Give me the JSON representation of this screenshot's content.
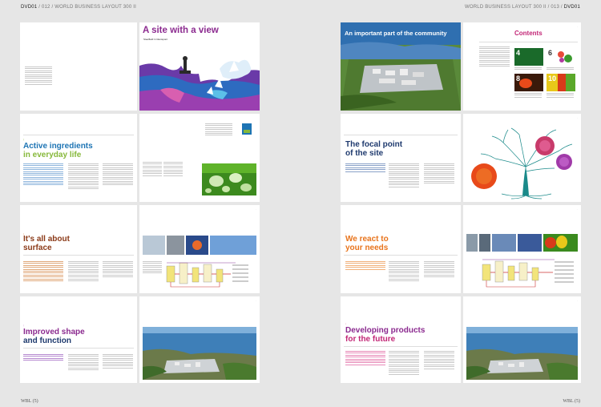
{
  "header": {
    "left_code": "DVD01",
    "left_sep": "/",
    "left_page": "012",
    "left_title": "WORLD BUSINESS LAYOUT 300 II",
    "right_title": "WORLD BUSINESS LAYOUT 300 II",
    "right_page": "013",
    "right_code": "DVD01"
  },
  "footer": {
    "left": "WBL (5)",
    "right": "WBL (5)"
  },
  "spreads": {
    "s1": {
      "title": "A site with a view",
      "subtitle": "Steelfield in Glenspont"
    },
    "s2": {
      "title_line1": "Active ingredients",
      "title_line2": "in everyday life"
    },
    "s3": {
      "title_line1": "It's all about",
      "title_line2": "surface"
    },
    "s4": {
      "title_line1": "Improved shape",
      "title_line2": "and function"
    },
    "s5": {
      "title": "An important part of the community",
      "contents_title": "Contents",
      "contents_tiles": [
        "4",
        "6",
        "8",
        "10"
      ]
    },
    "s6": {
      "title_line1": "The focal point",
      "title_line2": "of the site"
    },
    "s7": {
      "title_line1": "We react to",
      "title_line2": "your needs"
    },
    "s8": {
      "title_line1": "Developing products",
      "title_line2": "for the future"
    }
  },
  "colors": {
    "purple": "#8b2a8f",
    "blue_title": "#1d74b4",
    "green": "#86b83a",
    "brown": "#8b3a18",
    "orange": "#e8741c",
    "magenta": "#c22676",
    "navy": "#1f3a6e"
  }
}
